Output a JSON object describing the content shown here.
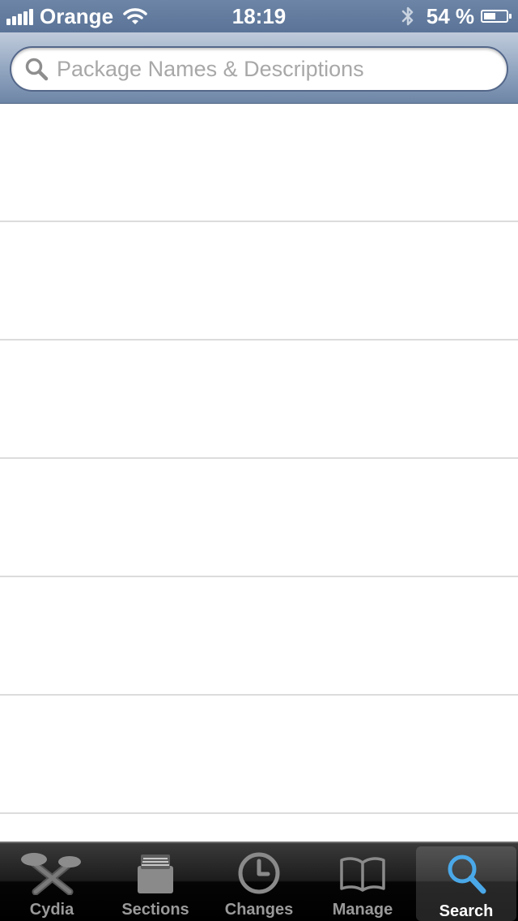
{
  "status_bar": {
    "carrier": "Orange",
    "time": "18:19",
    "battery_text": "54 %",
    "battery_level": 0.54
  },
  "search": {
    "placeholder": "Package Names & Descriptions",
    "value": ""
  },
  "list": {
    "rows": [
      "",
      "",
      "",
      "",
      "",
      "",
      ""
    ]
  },
  "tabs": [
    {
      "label": "Cydia",
      "icon": "cydia-icon",
      "active": false
    },
    {
      "label": "Sections",
      "icon": "sections-icon",
      "active": false
    },
    {
      "label": "Changes",
      "icon": "clock-icon",
      "active": false
    },
    {
      "label": "Manage",
      "icon": "book-icon",
      "active": false
    },
    {
      "label": "Search",
      "icon": "search-icon",
      "active": true
    }
  ],
  "colors": {
    "status_bar": "#5a7397",
    "active_tab_icon": "#4aa8e8",
    "inactive_tab_icon": "#8a8a8a"
  }
}
